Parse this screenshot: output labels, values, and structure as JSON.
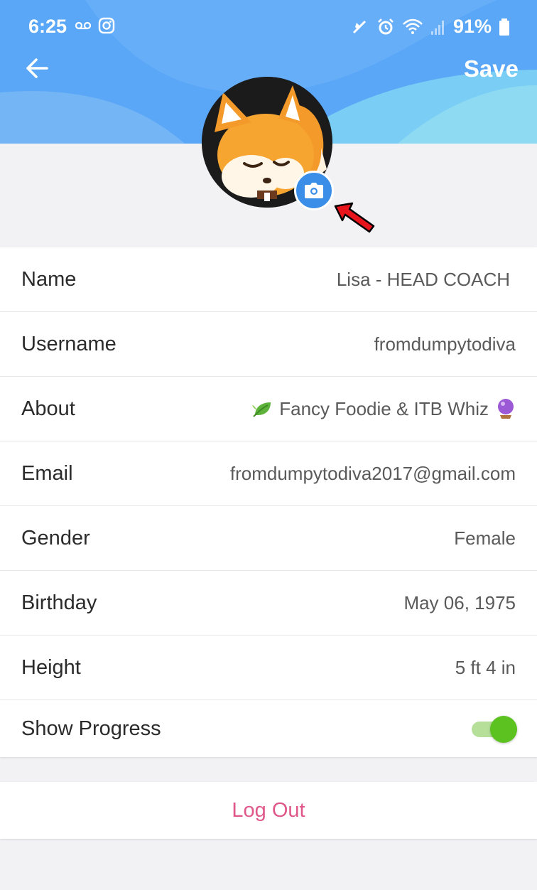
{
  "status_bar": {
    "time": "6:25",
    "battery_percent": "91%",
    "icons_left": [
      "voicemail-icon",
      "instagram-icon"
    ],
    "icons_right": [
      "mute-icon",
      "alarm-icon",
      "wifi-icon",
      "signal-icon",
      "battery-icon"
    ]
  },
  "header": {
    "back_icon": "arrow-left-icon",
    "save_label": "Save",
    "accent_color": "#5aa6f7"
  },
  "avatar": {
    "image": "fox-character-avatar",
    "camera_icon": "camera-icon",
    "camera_color": "#3a8ee8"
  },
  "profile": {
    "fields": [
      {
        "label": "Name",
        "value": "Lisa - HEAD COACH"
      },
      {
        "label": "Username",
        "value": "fromdumpytodiva"
      },
      {
        "label": "About",
        "value": "Fancy Foodie & ITB Whiz"
      },
      {
        "label": "Email",
        "value": "fromdumpytodiva2017@gmail.com"
      },
      {
        "label": "Gender",
        "value": "Female"
      },
      {
        "label": "Birthday",
        "value": "May 06, 1975"
      },
      {
        "label": "Height",
        "value": "5 ft 4 in"
      }
    ],
    "show_progress": {
      "label": "Show Progress",
      "enabled": true,
      "toggle_color": "#5cc21f"
    }
  },
  "logout": {
    "label": "Log Out",
    "color": "#e0588a"
  }
}
